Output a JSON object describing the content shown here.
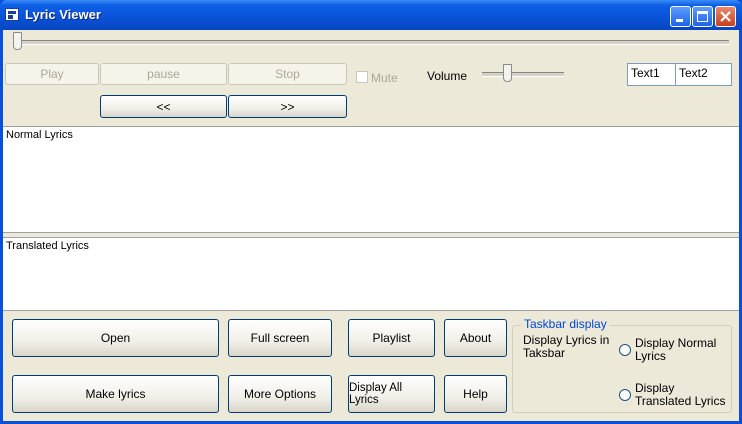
{
  "window": {
    "title": "Lyric Viewer"
  },
  "position_slider": {
    "value_percent": 0
  },
  "transport": {
    "play_label": "Play",
    "pause_label": "pause",
    "stop_label": "Stop",
    "prev_label": "<<",
    "next_label": ">>"
  },
  "mute": {
    "label": "Mute",
    "checked": false
  },
  "volume": {
    "label": "Volume",
    "value_percent": 30
  },
  "textboxes": {
    "text1": "Text1",
    "text2": "Text2"
  },
  "lyrics": {
    "normal_label": "Normal Lyrics",
    "translated_label": "Translated Lyrics"
  },
  "buttons": {
    "open": "Open",
    "full_screen": "Full screen",
    "playlist": "Playlist",
    "about": "About",
    "make_lyrics": "Make lyrics",
    "more_options": "More Options",
    "display_all_lyrics": "Display All Lyrics",
    "help": "Help"
  },
  "taskbar": {
    "title": "Taskbar display",
    "description": "Display Lyrics in Taksbar",
    "option_normal": "Display Normal Lyrics",
    "option_translated": "Display Translated Lyrics"
  },
  "colors": {
    "titlebar": "#0a52d6",
    "window_bg": "#ece9d8",
    "group_title": "#0046d5"
  }
}
